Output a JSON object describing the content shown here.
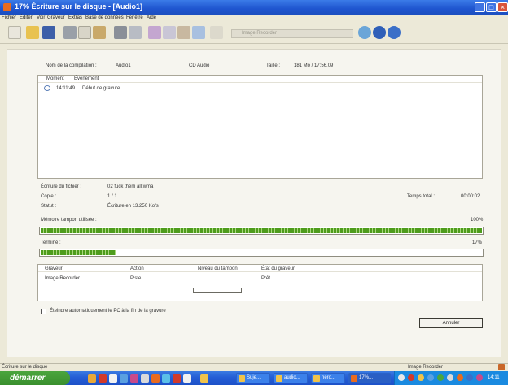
{
  "window": {
    "title": "17% Écriture sur le disque - [Audio1]",
    "buttons": {
      "minimize": "_",
      "maximize": "□",
      "close": "×"
    }
  },
  "menu": [
    "Fichier",
    "Éditer",
    "Voir",
    "Graveur",
    "Extras",
    "Base de données",
    "Fenêtre",
    "Aide"
  ],
  "toolbar": {
    "icons": [
      "new-icon",
      "open-icon",
      "save-icon",
      "cut-icon",
      "copy-icon",
      "paste-icon",
      "burn-icon",
      "erase-icon",
      "settings-icon",
      "info-icon",
      "help-icon"
    ],
    "recorder_select": "Image Recorder"
  },
  "compilation": {
    "name_label": "Nom de la compilation :",
    "name_value": "Audio1",
    "type": "CD Audio",
    "size_label": "Taille :",
    "size_value": "181 Mo  /  17:56.09"
  },
  "log": {
    "columns": [
      "Moment",
      "Événement"
    ],
    "rows": [
      {
        "time": "14:11:49",
        "event": "Début de gravure"
      }
    ]
  },
  "status": {
    "file_label": "Écriture du fichier :",
    "file_value": "02 fuck them all.wma",
    "copy_label": "Copie :",
    "copy_value": "1 / 1",
    "status_label": "Statut :",
    "status_value": "Écriture en 13.250 Ko/s",
    "total_time_label": "Temps total :",
    "total_time_value": "00:00:02"
  },
  "buffer": {
    "label": "Mémoire tampon utilisée :",
    "percent_text": "100%",
    "value": 1.0
  },
  "progress": {
    "label": "Terminé :",
    "percent_text": "17%",
    "value": 0.17
  },
  "drives": {
    "columns": [
      "Graveur",
      "Action",
      "Niveau du tampon",
      "État du graveur"
    ],
    "rows": [
      {
        "recorder": "Image Recorder",
        "action": "Piste",
        "state": "Prêt"
      }
    ]
  },
  "shutdown_checkbox": {
    "label": "Éteindre automatiquement le PC à la fin de la gravure",
    "checked": false
  },
  "cancel_button": "Annuler",
  "statusbar": {
    "left": "Écriture sur le disque",
    "right": "Image Recorder"
  },
  "taskbar": {
    "start": "démarrer",
    "tasks": [
      "Suje...",
      "audio...",
      "nero...",
      "17%..."
    ],
    "clock": "14:11"
  },
  "colors": {
    "titlebar": "#245dd5",
    "progress_fill": "#4e9c1c",
    "taskbar": "#245dd5",
    "start": "#3a8f2e"
  }
}
